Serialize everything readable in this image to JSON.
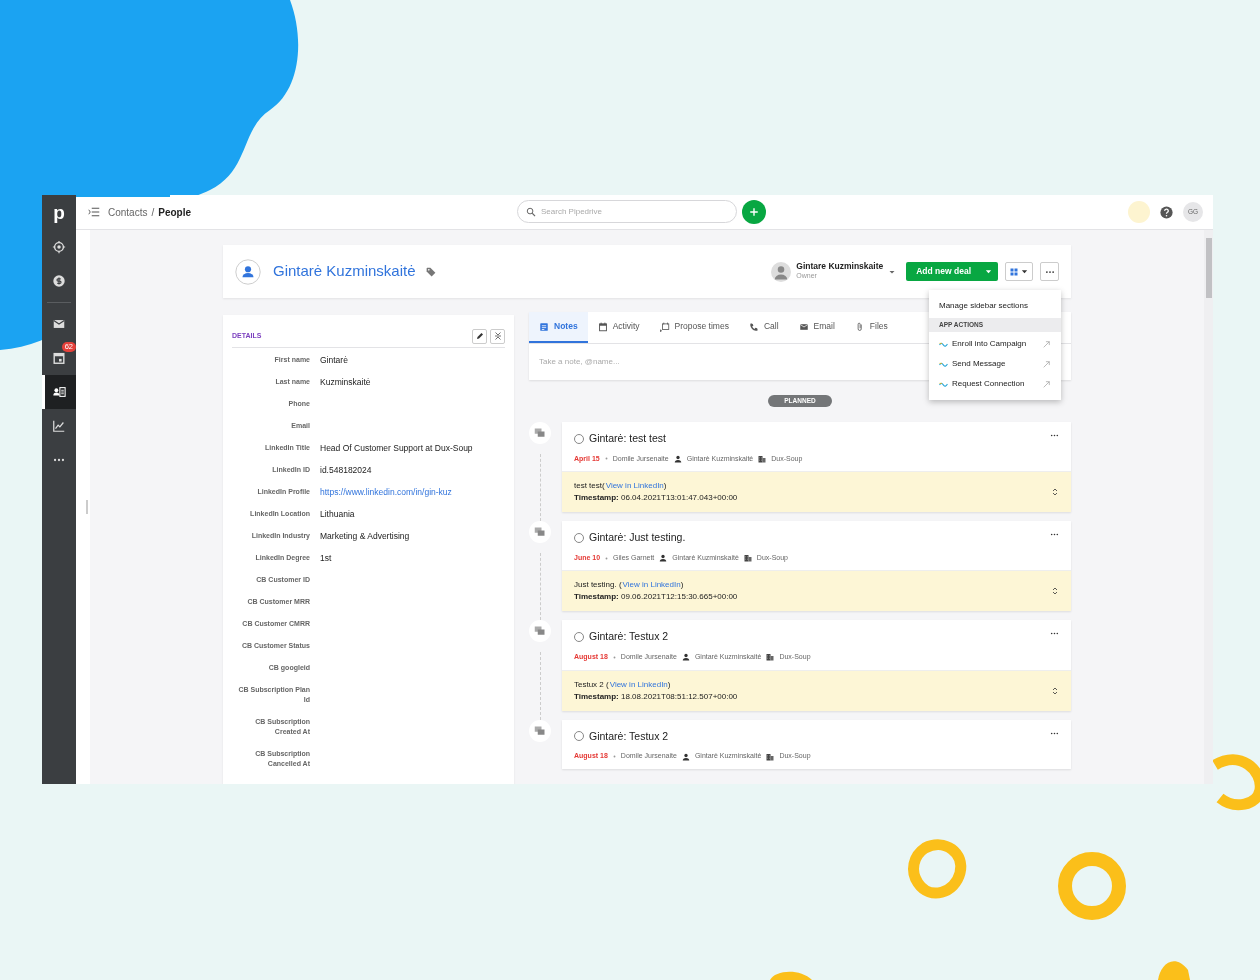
{
  "sidebar": {
    "logo": "p",
    "sections": [
      [
        {
          "kind": "leads",
          "selected": false
        },
        {
          "kind": "deals",
          "selected": false
        }
      ],
      [
        {
          "kind": "mail",
          "selected": false
        },
        {
          "kind": "calendar",
          "selected": false,
          "badge": "62"
        },
        {
          "kind": "contacts",
          "selected": true
        },
        {
          "kind": "insights",
          "selected": false
        },
        {
          "kind": "more",
          "selected": false
        }
      ]
    ]
  },
  "topbar": {
    "loading_bar": {
      "level": 0.083
    },
    "breadcrumb": [
      "Contacts",
      "People"
    ],
    "separator": "/",
    "search": {
      "placeholder": "Search Pipedrive"
    },
    "avatar": "GG"
  },
  "person": {
    "name": "Gintarė Kuzminskaitė",
    "owner": {
      "name": "Gintare Kuzminskaite",
      "role": "Owner"
    },
    "add_deal": "Add new deal"
  },
  "menu": {
    "items": [
      {
        "kind": "item",
        "label": "Manage sidebar sections"
      },
      {
        "kind": "header",
        "label": "APP ACTIONS"
      },
      {
        "kind": "app",
        "label": "Enroll into Campaign"
      },
      {
        "kind": "app",
        "label": "Send Message"
      },
      {
        "kind": "app",
        "label": "Request Connection"
      }
    ]
  },
  "details": {
    "title": "DETAILS",
    "fields": [
      {
        "label": "First name",
        "value": "Gintarė"
      },
      {
        "label": "Last name",
        "value": "Kuzminskaitė"
      },
      {
        "label": "Phone"
      },
      {
        "label": "Email"
      },
      {
        "label": "LinkedIn Title",
        "value": "Head Of Customer Support at Dux-Soup"
      },
      {
        "label": "LinkedIn ID",
        "value": "id.548182024"
      },
      {
        "label": "LinkedIn Profile",
        "value": "https://www.linkedin.com/in/gin-kuz",
        "kind": "link"
      },
      {
        "label": "LinkedIn Location",
        "value": "Lithuania"
      },
      {
        "label": "LinkedIn Industry",
        "value": "Marketing & Advertising"
      },
      {
        "label": "LinkedIn Degree",
        "value": "1st"
      },
      {
        "label": "CB Customer ID"
      },
      {
        "label": "CB Customer MRR"
      },
      {
        "label": "CB Customer CMRR"
      },
      {
        "label": "CB Customer Status"
      },
      {
        "label": "CB googleid"
      },
      {
        "label": "CB Subscription Plan Id"
      },
      {
        "label": "CB Subscription Created At"
      },
      {
        "label": "CB Subscription Cancelled At"
      }
    ]
  },
  "composer": {
    "tabs": [
      {
        "kind": "notes",
        "label": "Notes",
        "selected": true
      },
      {
        "kind": "activity",
        "label": "Activity",
        "selected": false
      },
      {
        "kind": "propose",
        "label": "Propose times",
        "selected": false
      },
      {
        "kind": "call",
        "label": "Call",
        "selected": false
      },
      {
        "kind": "email",
        "label": "Email",
        "selected": false
      },
      {
        "kind": "files",
        "label": "Files",
        "selected": false
      }
    ],
    "placeholder": "Take a note, @name..."
  },
  "timeline": {
    "divider": "PLANNED",
    "activities": [
      {
        "title": "Gintarė: test test",
        "checked": false,
        "date": "April 15",
        "user": "Domile Jursenaite",
        "person": "Gintarė Kuzminskaitė",
        "org": "Dux-Soup",
        "note": {
          "before": "test test(",
          "link": "View in LinkedIn",
          "after": ")",
          "timestamp": "**Timestamp:** 06.04.2021T13:01:47.043+00:00"
        }
      },
      {
        "title": "Gintarė: Just testing.",
        "checked": false,
        "date": "June 10",
        "user": "Giles Garnett",
        "person": "Gintarė Kuzminskaitė",
        "org": "Dux-Soup",
        "note": {
          "before": "Just testing. (",
          "link": "View in LinkedIn",
          "after": ")",
          "timestamp": "**Timestamp:** 09.06.2021T12:15:30.665+00:00"
        }
      },
      {
        "title": "Gintarė: Testux 2",
        "checked": false,
        "date": "August 18",
        "user": "Domile Jursenaite",
        "person": "Gintarė Kuzminskaitė",
        "org": "Dux-Soup",
        "note": {
          "before": "Testux 2 (",
          "link": "View in LinkedIn",
          "after": ")",
          "timestamp": "**Timestamp:** 18.08.2021T08:51:12.507+00:00"
        }
      },
      {
        "title": "Gintarė: Testux 2",
        "checked": false,
        "date": "August 18",
        "user": "Domile Jursenaite",
        "person": "Gintarė Kuzminskaitė",
        "org": "Dux-Soup"
      }
    ]
  }
}
